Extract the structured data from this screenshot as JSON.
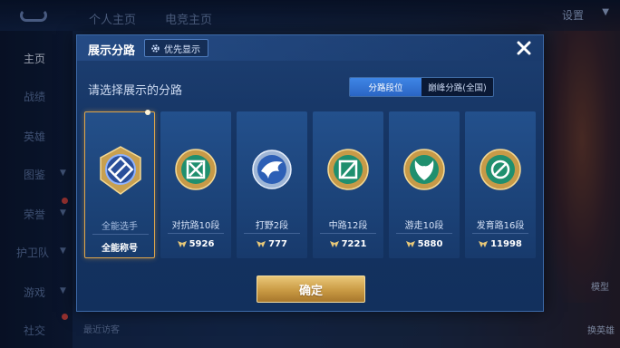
{
  "background": {
    "tabs": [
      "个人主页",
      "电竞主页"
    ],
    "settings_label": "设置",
    "sidebar": [
      "主页",
      "战绩",
      "英雄",
      "图鉴",
      "荣誉",
      "护卫队",
      "游戏",
      "社交"
    ],
    "bottom_text": "最近访客",
    "right_labels": [
      "模型",
      "换英雄"
    ]
  },
  "modal": {
    "title": "展示分路",
    "priority_label": "优先显示",
    "subtitle": "请选择展示的分路",
    "toggle": {
      "options": [
        "分路段位",
        "巅峰分路(全国)"
      ],
      "selected": "分路段位"
    },
    "cards": [
      {
        "name": "全能选手",
        "score": "全能称号",
        "emblem": "all-round-emblem",
        "selected": true
      },
      {
        "name": "对抗路10段",
        "score": "5926",
        "emblem": "clash-lane-emblem",
        "selected": false
      },
      {
        "name": "打野2段",
        "score": "777",
        "emblem": "jungle-emblem",
        "selected": false
      },
      {
        "name": "中路12段",
        "score": "7221",
        "emblem": "mid-lane-emblem",
        "selected": false
      },
      {
        "name": "游走10段",
        "score": "5880",
        "emblem": "roam-emblem",
        "selected": false
      },
      {
        "name": "发育路16段",
        "score": "11998",
        "emblem": "farm-lane-emblem",
        "selected": false
      }
    ],
    "confirm_label": "确定"
  },
  "colors": {
    "accent_gold": "#e0a64a",
    "toggle_active": "#3f86e6",
    "emblem_green": "#2fb58a",
    "emblem_blue": "#3f7fe0"
  }
}
